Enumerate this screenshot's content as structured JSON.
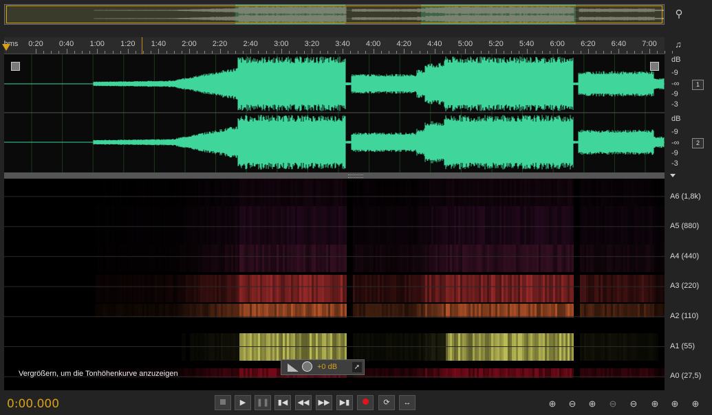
{
  "ruler": {
    "unit_label": "hms",
    "labels": [
      "0:20",
      "0:40",
      "1:00",
      "1:20",
      "1:40",
      "2:00",
      "2:20",
      "2:40",
      "3:00",
      "3:20",
      "3:40",
      "4:00",
      "4:20",
      "4:40",
      "5:00",
      "5:20",
      "5:40",
      "6:00",
      "6:20",
      "6:40",
      "7:00"
    ]
  },
  "db_scale": {
    "channel1": [
      "dB",
      "-9",
      "-∞",
      "-9",
      "-3"
    ],
    "channel2": [
      "dB",
      "-9",
      "-∞",
      "-9",
      "-3"
    ],
    "channel1_button": "1",
    "channel2_button": "2"
  },
  "note_scale": [
    "A6 (1,8k)",
    "A5 (880)",
    "A4 (440)",
    "A3 (220)",
    "A2 (110)",
    "A1 (55)",
    "A0 (27,5)"
  ],
  "hint_text": "Vergrößern, um die Tonhöhenkurve anzuzeigen",
  "hud": {
    "gain_label": "+0 dB"
  },
  "time_display": "0:00.000",
  "colors": {
    "waveform": "#3fd59b",
    "accent": "#d7a019",
    "selection": "#d8a400"
  },
  "transport": [
    "stop-icon",
    "play-icon",
    "pause-icon",
    "skip-start-icon",
    "rewind-icon",
    "fast-forward-icon",
    "skip-end-icon",
    "record-icon",
    "loop-icon",
    "skip-selection-icon"
  ],
  "zoom_tools": [
    "zoom-in-amplitude-icon",
    "zoom-out-amplitude-icon",
    "zoom-in-time-icon",
    "zoom-out-time-icon",
    "zoom-out-full-icon",
    "zoom-in-selection-icon",
    "zoom-in-left-icon",
    "zoom-in-right-icon"
  ]
}
